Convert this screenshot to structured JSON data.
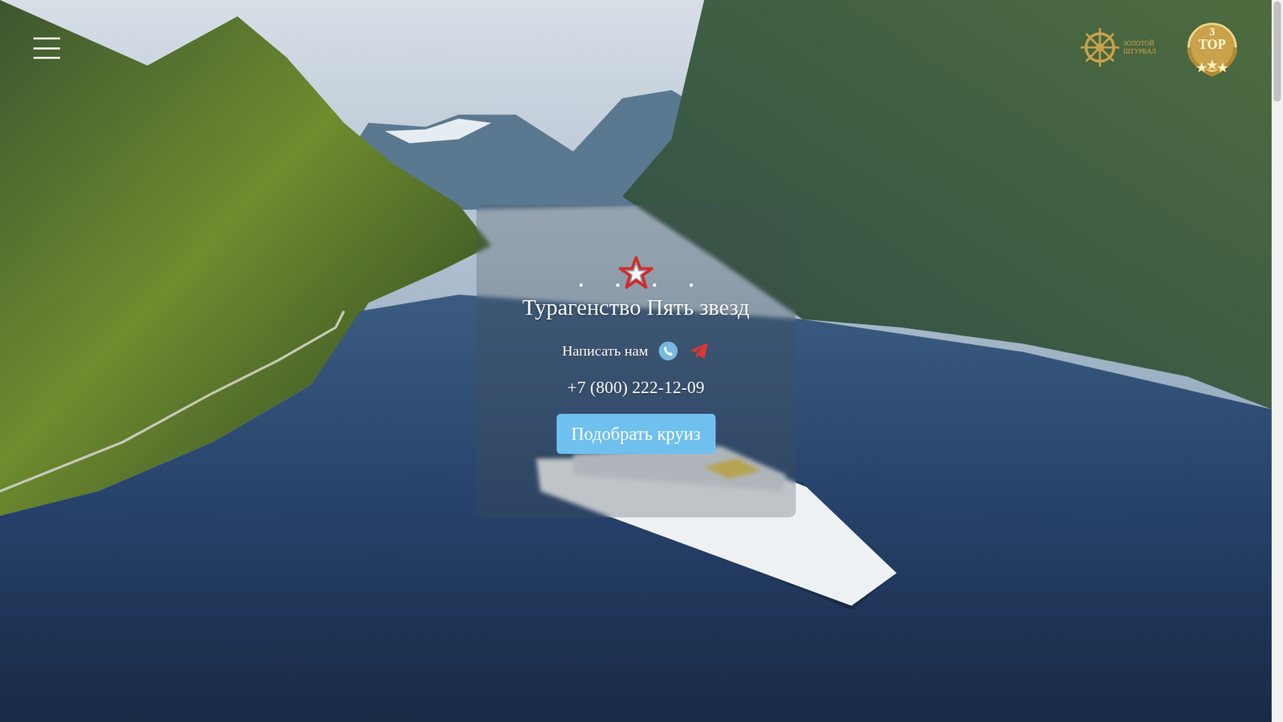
{
  "awards": [
    {
      "kind": "wheel",
      "label": "ЗОЛОТОЙ ШТУРВАЛ"
    },
    {
      "kind": "laurel",
      "label": "TOP",
      "number": "3"
    }
  ],
  "brand": {
    "title": "Турагенство Пять звезд"
  },
  "contact": {
    "label": "Написать нам",
    "phone": "+7 (800) 222-12-09"
  },
  "button": {
    "label": "Подобрать круиз"
  }
}
